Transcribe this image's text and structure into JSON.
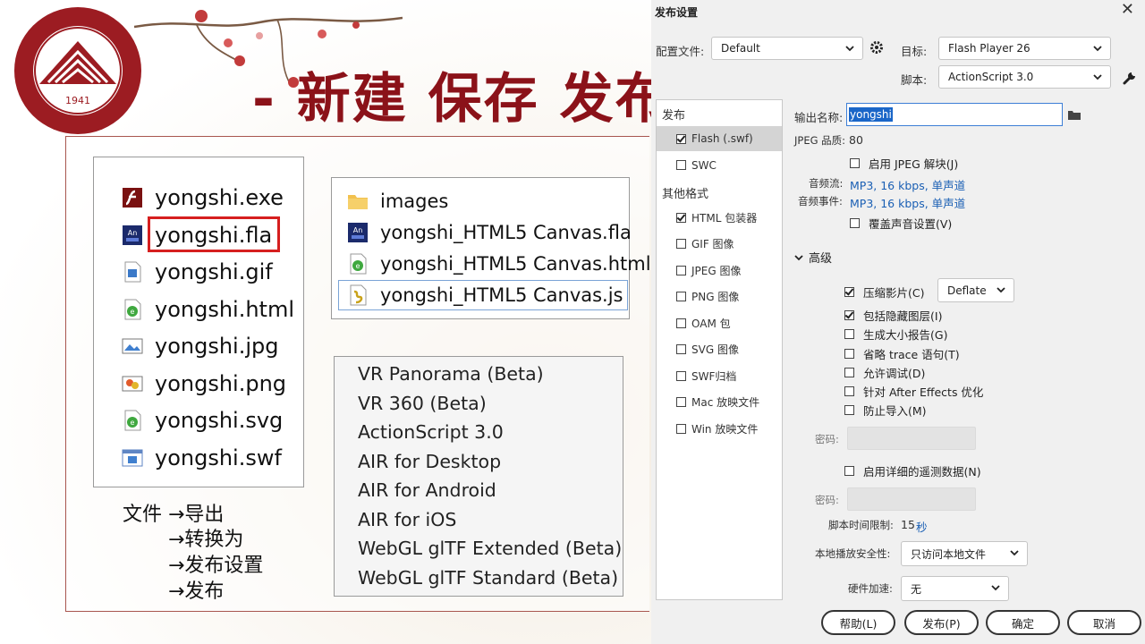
{
  "slide": {
    "title": "- 新建 保存 发布",
    "file_list_1": [
      {
        "name": "yongshi.exe",
        "icon": "flash-exe-icon"
      },
      {
        "name": "yongshi.fla",
        "icon": "animate-fla-icon"
      },
      {
        "name": "yongshi.gif",
        "icon": "gif-file-icon"
      },
      {
        "name": "yongshi.html",
        "icon": "html-file-icon"
      },
      {
        "name": "yongshi.jpg",
        "icon": "jpg-file-icon"
      },
      {
        "name": "yongshi.png",
        "icon": "png-file-icon"
      },
      {
        "name": "yongshi.svg",
        "icon": "svg-file-icon"
      },
      {
        "name": "yongshi.swf",
        "icon": "swf-file-icon"
      }
    ],
    "file_list_2": [
      {
        "name": "images",
        "icon": "folder-icon"
      },
      {
        "name": "yongshi_HTML5 Canvas.fla",
        "icon": "animate-fla-icon"
      },
      {
        "name": "yongshi_HTML5 Canvas.html",
        "icon": "html-file-icon"
      },
      {
        "name": "yongshi_HTML5 Canvas.js",
        "icon": "js-file-icon"
      }
    ],
    "targets": [
      "VR Panorama (Beta)",
      "VR 360 (Beta)",
      "ActionScript 3.0",
      "AIR for Desktop",
      "AIR for Android",
      "AIR for iOS",
      "WebGL glTF Extended (Beta)",
      "WebGL glTF Standard (Beta)"
    ],
    "menu_path": [
      "文件 →导出",
      "→转换为",
      "→发布设置",
      "→发布"
    ]
  },
  "dialog": {
    "title": "发布设置",
    "profile_label": "配置文件:",
    "profile_value": "Default",
    "target_label": "目标:",
    "target_value": "Flash Player 26",
    "script_label": "脚本:",
    "script_value": "ActionScript 3.0",
    "left_panel": {
      "publish_heading": "发布",
      "publish_items": [
        {
          "label": "Flash (.swf)",
          "checked": true
        },
        {
          "label": "SWC",
          "checked": false
        }
      ],
      "other_heading": "其他格式",
      "other_items": [
        {
          "label": "HTML 包装器",
          "checked": true
        },
        {
          "label": "GIF 图像",
          "checked": false
        },
        {
          "label": "JPEG 图像",
          "checked": false
        },
        {
          "label": "PNG 图像",
          "checked": false
        },
        {
          "label": "OAM 包",
          "checked": false
        },
        {
          "label": "SVG 图像",
          "checked": false
        },
        {
          "label": "SWF归档",
          "checked": false
        },
        {
          "label": "Mac 放映文件",
          "checked": false
        },
        {
          "label": "Win 放映文件",
          "checked": false
        }
      ]
    },
    "output_label": "输出名称:",
    "output_value": "yongshi",
    "jpeg_label": "JPEG 品质:",
    "jpeg_value": "80",
    "enable_jpeg": "启用 JPEG 解块(J)",
    "audio_stream_label": "音频流:",
    "audio_stream_value": "MP3, 16 kbps, 单声道",
    "audio_event_label": "音频事件:",
    "audio_event_value": "MP3, 16 kbps, 单声道",
    "override_sound": "覆盖声音设置(V)",
    "advanced_label": "高级",
    "options": [
      {
        "label": "压缩影片(C)",
        "checked": true
      },
      {
        "label": "包括隐藏图层(I)",
        "checked": true
      },
      {
        "label": "生成大小报告(G)",
        "checked": false
      },
      {
        "label": "省略 trace 语句(T)",
        "checked": false
      },
      {
        "label": "允许调试(D)",
        "checked": false
      },
      {
        "label": "针对 After Effects 优化",
        "checked": false
      },
      {
        "label": "防止导入(M)",
        "checked": false
      }
    ],
    "compress_value": "Deflate",
    "password_label": "密码:",
    "telemetry": "启用详细的遥测数据(N)",
    "script_time_label": "脚本时间限制:",
    "script_time_value": "15",
    "script_time_unit": "秒",
    "local_security_label": "本地播放安全性:",
    "local_security_value": "只访问本地文件",
    "hw_accel_label": "硬件加速:",
    "hw_accel_value": "无",
    "buttons": {
      "help": "帮助(L)",
      "publish": "发布(P)",
      "ok": "确定",
      "cancel": "取消"
    }
  }
}
